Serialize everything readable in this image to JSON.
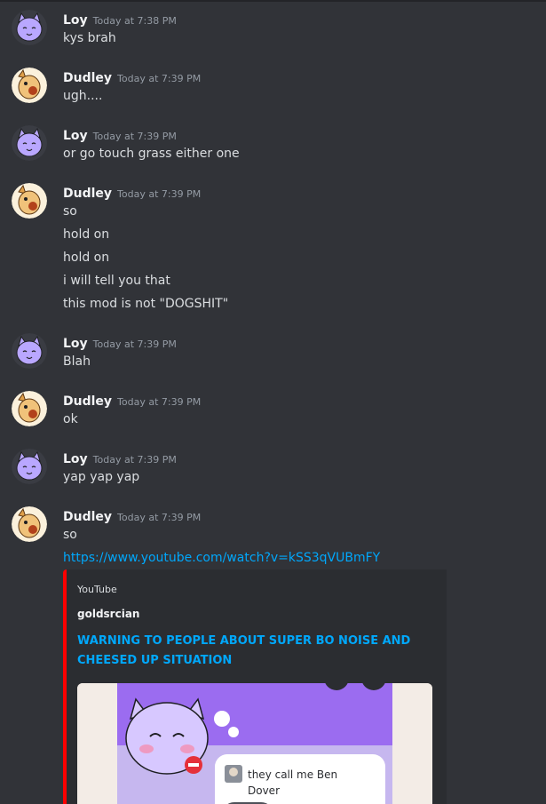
{
  "messages": [
    {
      "user": "Loy",
      "time": "Today at 7:38 PM",
      "lines": [
        "kys brah"
      ]
    },
    {
      "user": "Dudley",
      "time": "Today at 7:39 PM",
      "lines": [
        "ugh...."
      ]
    },
    {
      "user": "Loy",
      "time": "Today at 7:39 PM",
      "lines": [
        "or go touch grass either one"
      ]
    },
    {
      "user": "Dudley",
      "time": "Today at 7:39 PM",
      "lines": [
        "so",
        "hold on",
        "hold on",
        "i will tell you that",
        "this mod is not \"DOGSHIT\""
      ]
    },
    {
      "user": "Loy",
      "time": "Today at 7:39 PM",
      "lines": [
        "Blah"
      ]
    },
    {
      "user": "Dudley",
      "time": "Today at 7:39 PM",
      "lines": [
        "ok"
      ]
    },
    {
      "user": "Loy",
      "time": "Today at 7:39 PM",
      "lines": [
        "yap yap yap"
      ]
    },
    {
      "user": "Dudley",
      "time": "Today at 7:39 PM",
      "lines": [
        "so"
      ],
      "link": "https://www.youtube.com/watch?v=kSS3qVUBmFY"
    }
  ],
  "embed": {
    "provider": "YouTube",
    "author": "goldsrcian",
    "title": "WARNING TO PEOPLE ABOUT SUPER BO NOISE AND CHEESED UP SITUATION",
    "thumbnail_caption": "they call me Ben Dover"
  },
  "colors": {
    "background": "#313338",
    "link": "#00a8fc",
    "embed_border": "#ff0000",
    "loy_avatar": "#b9a7ff",
    "dudley_avatar": "#f0c27a"
  }
}
